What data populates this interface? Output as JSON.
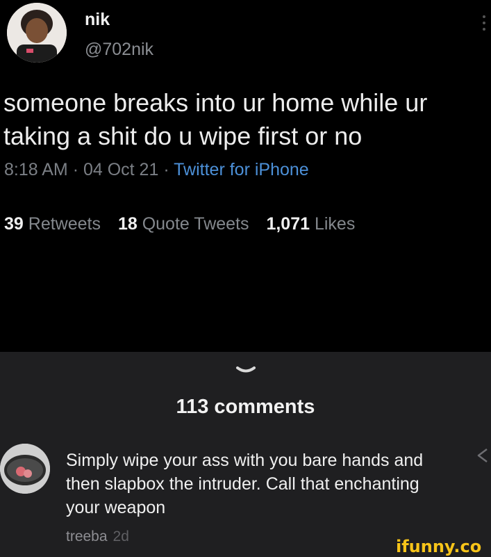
{
  "tweet": {
    "display_name": "nik",
    "handle": "@702nik",
    "text": "someone breaks into ur home while ur taking a shit do u wipe first or no",
    "time": "8:18 AM",
    "date": "04 Oct 21",
    "source": "Twitter for iPhone",
    "retweets_count": "39",
    "retweets_label": "Retweets",
    "quotes_count": "18",
    "quotes_label": "Quote Tweets",
    "likes_count": "1,071",
    "likes_label": "Likes"
  },
  "comments": {
    "count_label": "113 comments",
    "items": [
      {
        "text": "Simply wipe your ass with you bare hands and then slapbox the intruder. Call that enchanting your weapon",
        "author": "treeba",
        "age": "2d"
      }
    ]
  },
  "watermark": "ifunny.co",
  "colors": {
    "tweet_background": "#000000",
    "comments_background": "#1f1f21",
    "link": "#4c90d8",
    "watermark": "#f7c419"
  }
}
